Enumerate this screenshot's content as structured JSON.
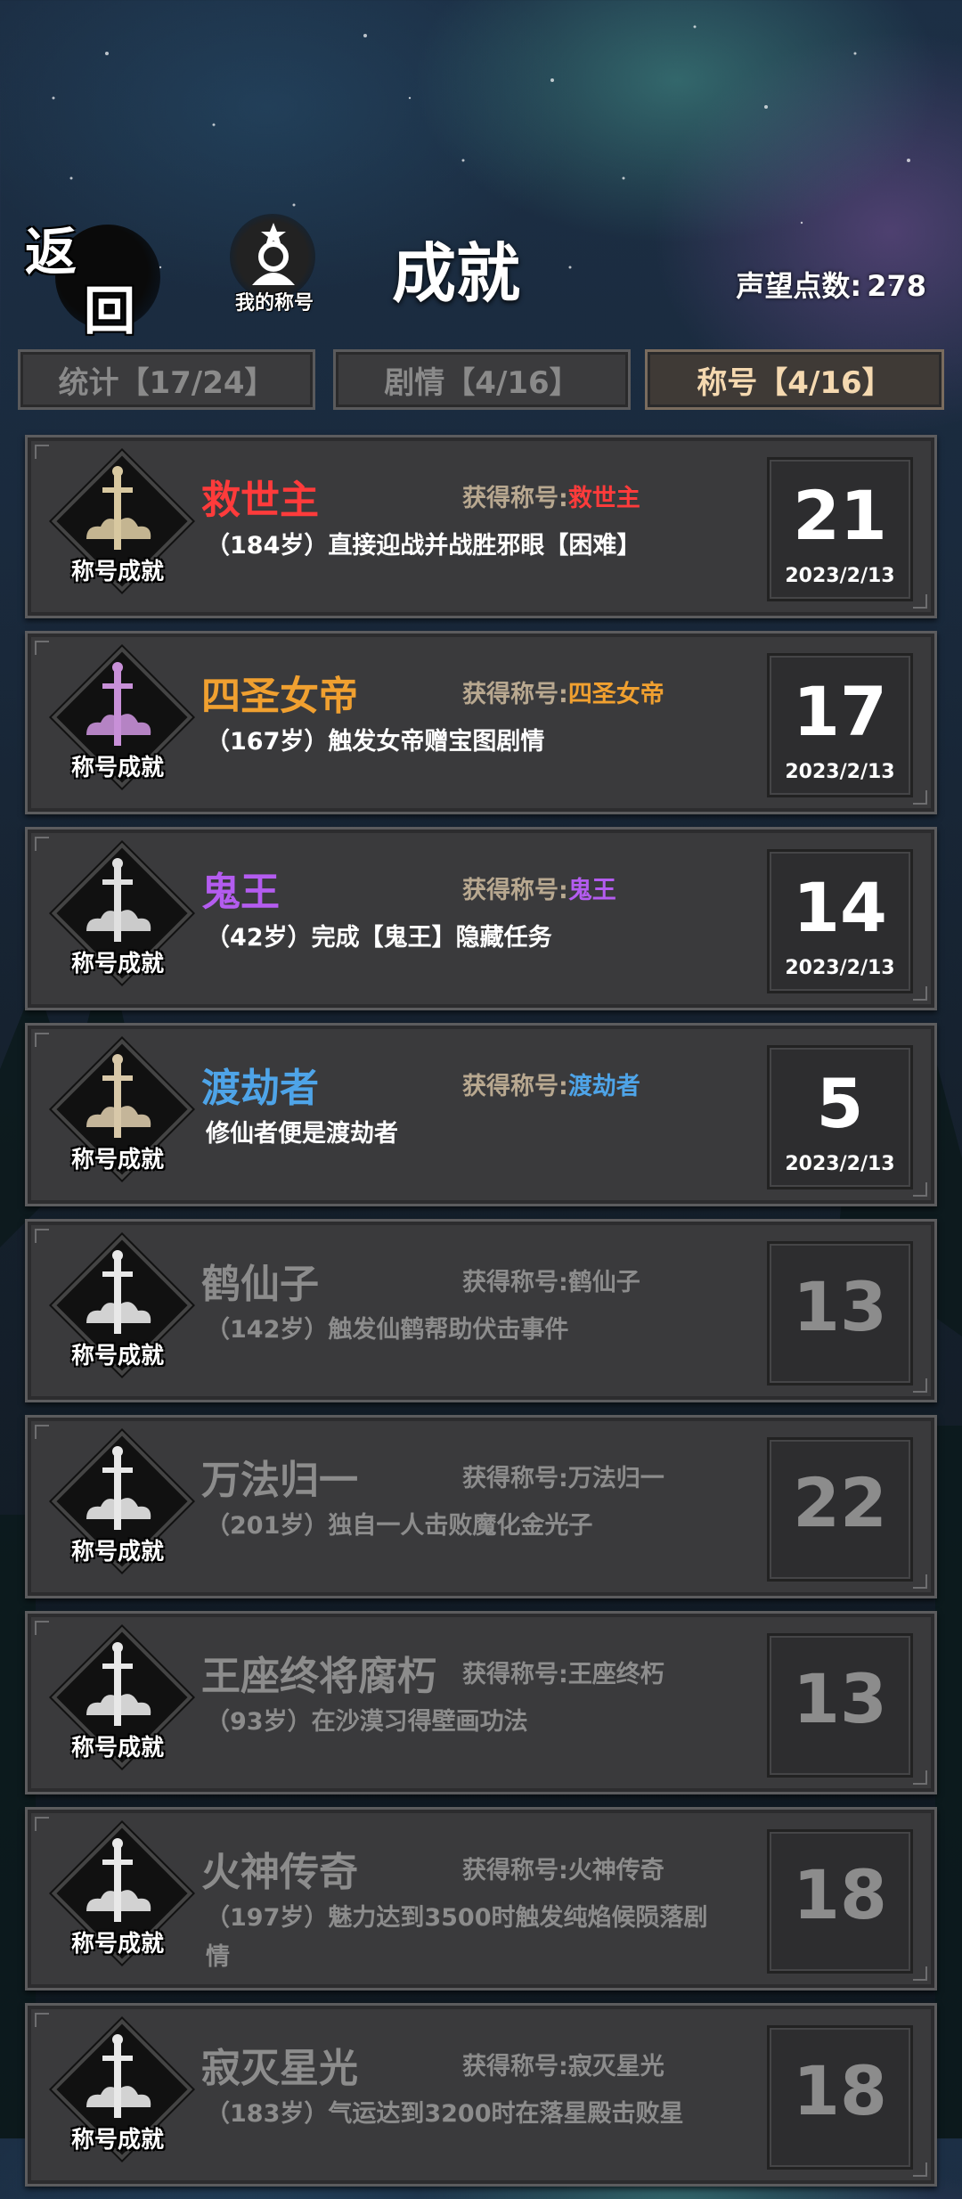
{
  "header": {
    "back": [
      "返",
      "回"
    ],
    "my_title_label": "我的称号",
    "page_title": "成就",
    "prestige_label": "声望点数:",
    "prestige_value": "278"
  },
  "tabs": [
    {
      "label": "统计【17/24】",
      "active": false
    },
    {
      "label": "剧情【4/16】",
      "active": false
    },
    {
      "label": "称号【4/16】",
      "active": true
    }
  ],
  "badge_label": "称号成就",
  "achievements": [
    {
      "name": "救世主",
      "gain": "获得称号:",
      "gain_title": "救世主",
      "desc": "（184岁）直接迎战并战胜邪眼【困难】",
      "score": "21",
      "date": "2023/2/13",
      "unlocked": true,
      "color": "#ff3b3b"
    },
    {
      "name": "四圣女帝",
      "gain": "获得称号:",
      "gain_title": "四圣女帝",
      "desc": "（167岁）触发女帝赠宝图剧情",
      "score": "17",
      "date": "2023/2/13",
      "unlocked": true,
      "color": "#f0a030"
    },
    {
      "name": "鬼王",
      "gain": "获得称号:",
      "gain_title": "鬼王",
      "desc": "（42岁）完成【鬼王】隐藏任务",
      "score": "14",
      "date": "2023/2/13",
      "unlocked": true,
      "color": "#b45cf0"
    },
    {
      "name": "渡劫者",
      "gain": "获得称号:",
      "gain_title": "渡劫者",
      "desc": "修仙者便是渡劫者",
      "score": "5",
      "date": "2023/2/13",
      "unlocked": true,
      "color": "#4ea4e8"
    },
    {
      "name": "鹤仙子",
      "gain": "获得称号:",
      "gain_title": "鹤仙子",
      "desc": "（142岁）触发仙鹤帮助伏击事件",
      "score": "13",
      "date": "",
      "unlocked": false,
      "color": "#8c8c8c"
    },
    {
      "name": "万法归一",
      "gain": "获得称号:",
      "gain_title": "万法归一",
      "desc": "（201岁）独自一人击败魔化金光子",
      "score": "22",
      "date": "",
      "unlocked": false,
      "color": "#8c8c8c"
    },
    {
      "name": "王座终将腐朽",
      "gain": "获得称号:",
      "gain_title": "王座终朽",
      "desc": "（93岁）在沙漠习得壁画功法",
      "score": "13",
      "date": "",
      "unlocked": false,
      "color": "#8c8c8c"
    },
    {
      "name": "火神传奇",
      "gain": "获得称号:",
      "gain_title": "火神传奇",
      "desc": "（197岁）魅力达到3500时触发纯焰候陨落剧情",
      "score": "18",
      "date": "",
      "unlocked": false,
      "color": "#8c8c8c"
    },
    {
      "name": "寂灭星光",
      "gain": "获得称号:",
      "gain_title": "寂灭星光",
      "desc": "（183岁）气运达到3200时在落星殿击败星",
      "score": "18",
      "date": "",
      "unlocked": false,
      "color": "#8c8c8c"
    }
  ],
  "colors": {
    "gain_label": "#b8a890",
    "dim": "#8c8c8c"
  }
}
